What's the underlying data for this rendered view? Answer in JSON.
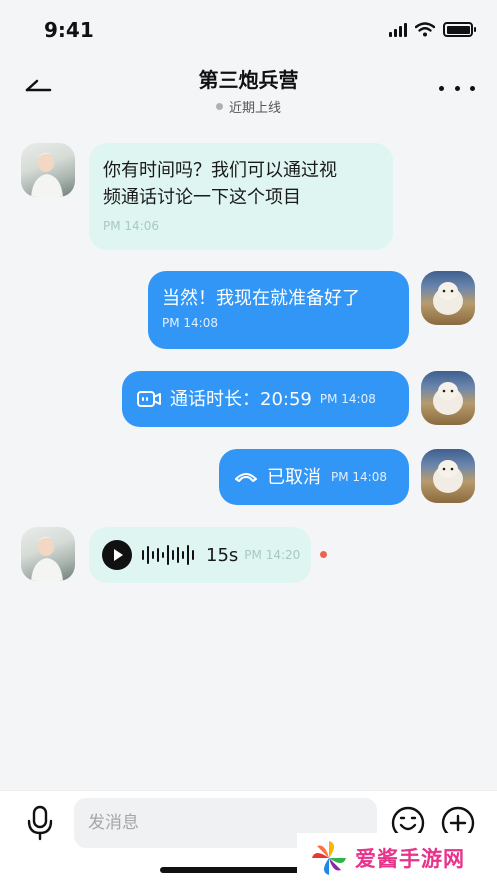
{
  "status_bar": {
    "time": "9:41"
  },
  "header": {
    "title": "第三炮兵营",
    "presence": "近期上线"
  },
  "messages": [
    {
      "side": "in",
      "type": "text",
      "text_line1": "你有时间吗？我们可以通过视",
      "text_line2": "频通话讨论一下这个项目",
      "time": "PM 14:06"
    },
    {
      "side": "out",
      "type": "text",
      "text": "当然！我现在就准备好了",
      "time": "PM 14:08"
    },
    {
      "side": "out",
      "type": "call",
      "text": "通话时长：20:59",
      "time": "PM 14:08",
      "icon": "video-call-icon"
    },
    {
      "side": "out",
      "type": "call",
      "text": "已取消",
      "time": "PM 14:08",
      "icon": "hang-up-icon"
    },
    {
      "side": "in",
      "type": "voice",
      "duration": "15s",
      "time": "PM 14:20",
      "unread": true
    }
  ],
  "input_bar": {
    "placeholder": "发消息"
  },
  "watermark": {
    "text": "爱酱手游网"
  },
  "colors": {
    "background": "#f4f5f7",
    "incoming_bubble": "#dff5f1",
    "outgoing_bubble": "#3296f6",
    "unread_dot": "#f0624d",
    "watermark_text": "#e7338a"
  }
}
